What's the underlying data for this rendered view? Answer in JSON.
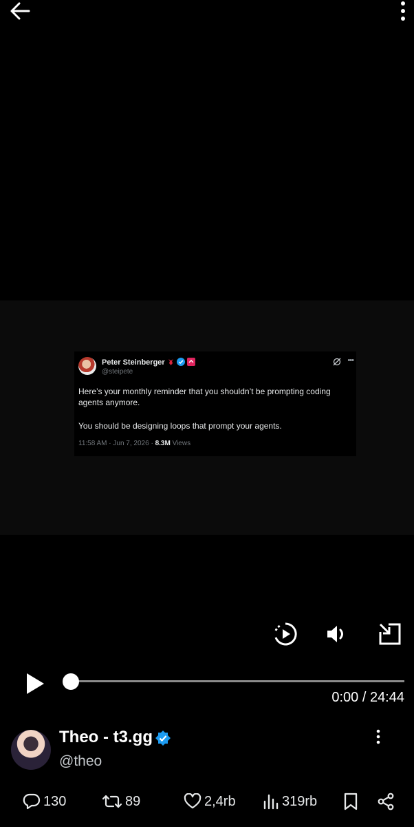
{
  "header": {
    "back_icon": "arrow-left-icon",
    "more_icon": "more-vertical-icon"
  },
  "tweet": {
    "author_name": "Peter Steinberger",
    "handle": "@steipete",
    "text_line1": "Here’s your monthly reminder that you shouldn’t be prompting coding agents anymore.",
    "text_line2": "You should be designing loops that prompt your agents.",
    "time": "11:58 AM · Jun 7, 2026 · ",
    "views_count": "8.3M",
    "views_label": " Views"
  },
  "player": {
    "replay_icon": "autoplay-icon",
    "volume_icon": "volume-icon",
    "pip_icon": "picture-in-picture-icon",
    "progress_fraction": 0,
    "time": "0:00 / 24:44"
  },
  "author": {
    "name": "Theo - t3.gg",
    "handle": "@theo"
  },
  "actions": {
    "replies": "130",
    "reposts": "89",
    "likes": "2,4rb",
    "views": "319rb"
  },
  "colors": {
    "verified": "#1d9bf0",
    "background": "#000000"
  }
}
